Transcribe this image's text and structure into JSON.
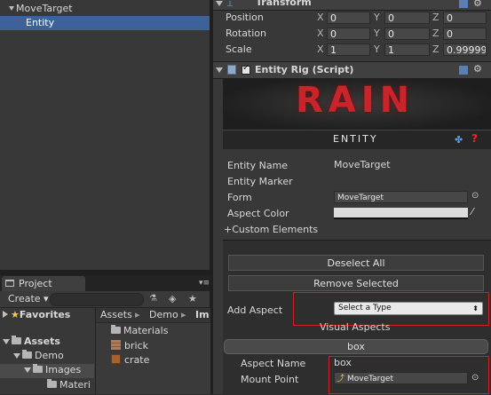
{
  "hierarchy": {
    "items": [
      {
        "label": "MoveTarget",
        "selected": false
      },
      {
        "label": "Entity",
        "selected": true
      }
    ]
  },
  "project": {
    "tab_label": "Project",
    "create_label": "Create",
    "favorites_label": "Favorites",
    "tree": [
      "Assets",
      "Demo",
      "Images",
      "Materi"
    ],
    "breadcrumb": [
      "Assets",
      "Demo",
      "Im"
    ],
    "files": [
      "Materials",
      "brick",
      "crate"
    ]
  },
  "transform": {
    "title": "Transform",
    "rows": [
      {
        "label": "Position",
        "x": "0",
        "y": "0",
        "z": "0"
      },
      {
        "label": "Rotation",
        "x": "0",
        "y": "0",
        "z": "0"
      },
      {
        "label": "Scale",
        "x": "1",
        "y": "1",
        "z": "0.99999"
      }
    ]
  },
  "component": {
    "title": "Entity Rig (Script)",
    "logo_text": "RAIN",
    "section_title": "ENTITY",
    "fields": {
      "entity_name_label": "Entity Name",
      "entity_name_value": "MoveTarget",
      "entity_marker_label": "Entity Marker",
      "form_label": "Form",
      "form_value": "MoveTarget",
      "aspect_color_label": "Aspect Color",
      "custom_elements_label": "Custom Elements"
    },
    "deselect_label": "Deselect All",
    "remove_label": "Remove Selected",
    "add_aspect_label": "Add Aspect",
    "add_aspect_select": "Select a Type",
    "visual_aspects_label": "Visual Aspects",
    "aspect_header": "box",
    "aspect_name_label": "Aspect Name",
    "aspect_name_value": "box",
    "mount_point_label": "Mount Point",
    "mount_point_value": "MoveTarget"
  },
  "colors": {
    "selection": "#3d6199",
    "logo_red": "#c8242a",
    "highlight_box": "#d21f1f"
  }
}
